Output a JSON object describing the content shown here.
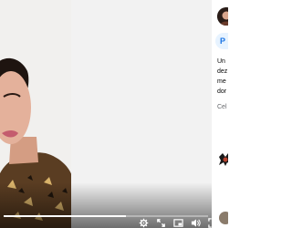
{
  "video": {
    "progress_fraction": 0.6
  },
  "controls": {
    "settings_icon": "gear-icon",
    "expand_icon": "expand-icon",
    "pip_icon": "picture-in-picture-icon",
    "volume_icon": "speaker-icon",
    "fullscreen_icon": "fullscreen-icon"
  },
  "panel": {
    "button_label": "P",
    "description_lines": [
      "Un",
      "dez",
      "me",
      "dor"
    ],
    "more_label": "Cel"
  },
  "colors": {
    "accent": "#1b74e4",
    "pill_bg": "#e7f3ff"
  }
}
